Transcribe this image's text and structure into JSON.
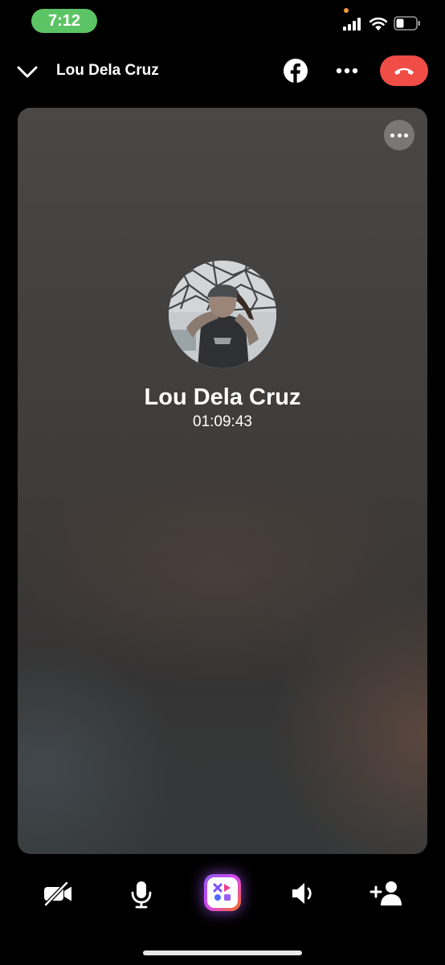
{
  "status_bar": {
    "time": "7:12"
  },
  "header": {
    "title": "Lou Dela Cruz",
    "back_icon": "chevron-down-icon",
    "facebook_icon": "facebook-icon",
    "more_icon": "more-horizontal-icon",
    "end_call_icon": "hang-up-icon"
  },
  "call": {
    "name": "Lou Dela Cruz",
    "duration": "01:09:43"
  },
  "controls": {
    "items": [
      "video-off-icon",
      "microphone-icon",
      "effects-icon",
      "speaker-icon",
      "add-person-icon"
    ]
  },
  "colors": {
    "end_call": "#f04d46",
    "time_pill": "#5dc466",
    "privacy_dot": "#f09a37"
  }
}
